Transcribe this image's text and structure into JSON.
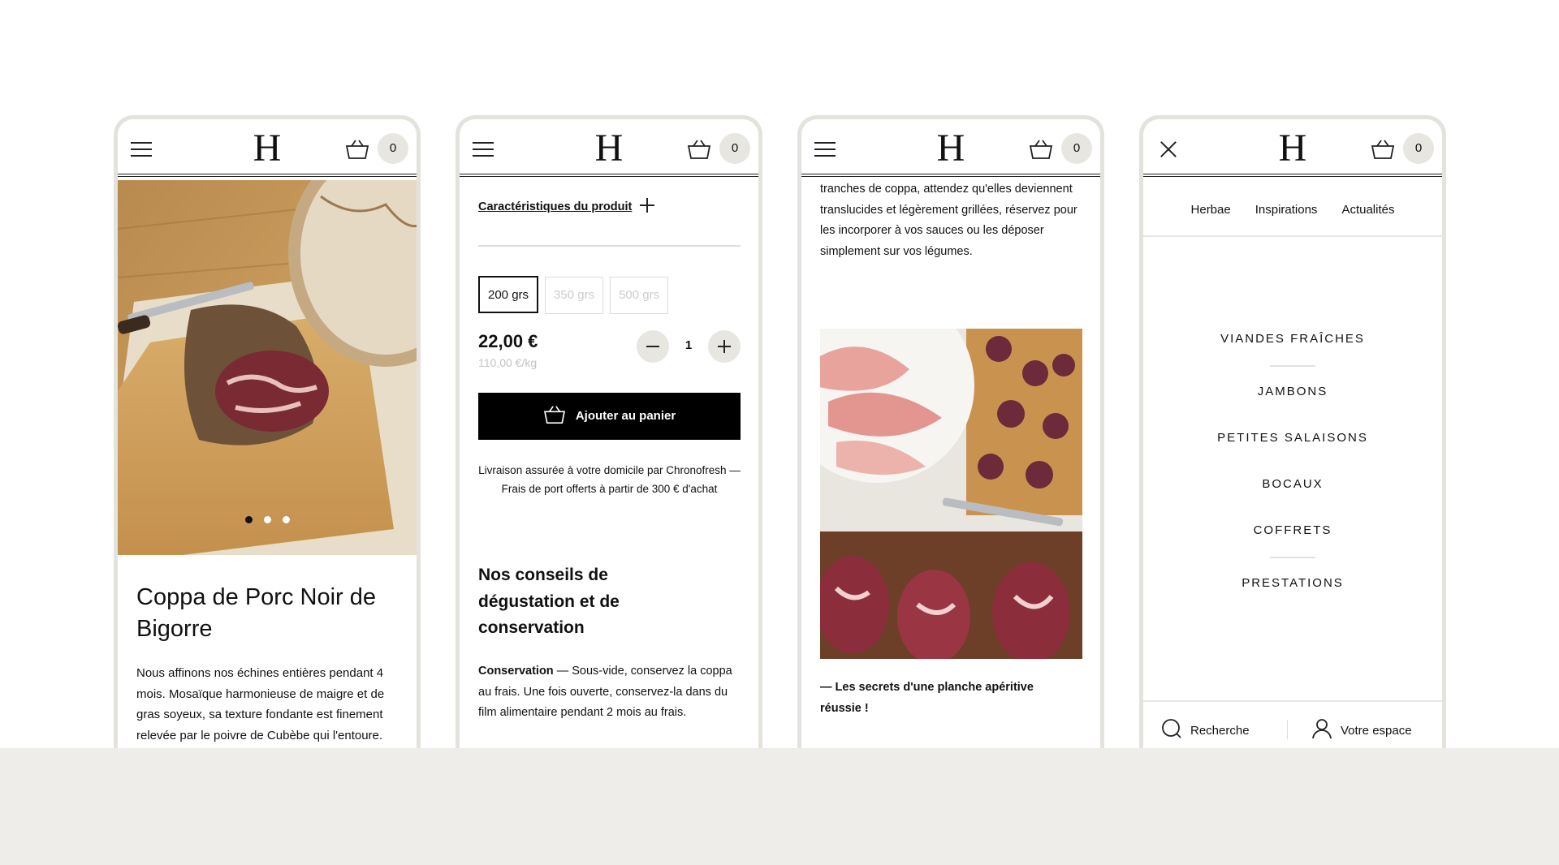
{
  "brand": {
    "logo_letter": "H"
  },
  "header": {
    "cart_count": "0"
  },
  "screen1": {
    "title": "Coppa de Porc Noir de Bigorre",
    "description": "Nous affinons nos échines entières pendant 4 mois. Mosaïque harmonieuse de maigre et de gras soyeux, sa texture fondante est finement relevée par le poivre de Cubèbe qui l'entoure.",
    "carousel_active_index": 0,
    "carousel_count": 3
  },
  "screen2": {
    "characteristics_link": "Caractéristiques du produit",
    "sizes": [
      {
        "label": "200 grs",
        "selected": true
      },
      {
        "label": "350 grs",
        "selected": false
      },
      {
        "label": "500 grs",
        "selected": false
      }
    ],
    "price": "22,00 €",
    "unit_price": "110,00 €/kg",
    "quantity": "1",
    "add_to_cart": "Ajouter au panier",
    "delivery_note": "Livraison assurée à votre domicile par Chronofresh  —  Frais de port offerts à partir de 300 € d'achat",
    "advice_title": "Nos conseils de dégustation et de conservation",
    "conservation_label": "Conservation",
    "conservation_text": "Sous-vide, conservez la coppa au frais. Une fois ouverte, conservez-la dans du film alimentaire pendant 2 mois au frais."
  },
  "screen3": {
    "article_text": "tranches de coppa, attendez qu'elles deviennent translucides et légèrement grillées, réservez pour les incorporer à vos sauces ou les déposer simplement sur vos légumes.",
    "article_link": "—  Les secrets d'une planche apéritive réussie !"
  },
  "screen4": {
    "nav_top": [
      "Herbae",
      "Inspirations",
      "Actualités"
    ],
    "categories": [
      "VIANDES FRAÎCHES",
      "JAMBONS",
      "PETITES SALAISONS",
      "BOCAUX",
      "COFFRETS",
      "PRESTATIONS"
    ],
    "search_label": "Recherche",
    "account_label": "Votre espace"
  },
  "colors": {
    "accent_grey": "#e8e6e1",
    "band": "#eeede9",
    "button_black": "#000000"
  }
}
